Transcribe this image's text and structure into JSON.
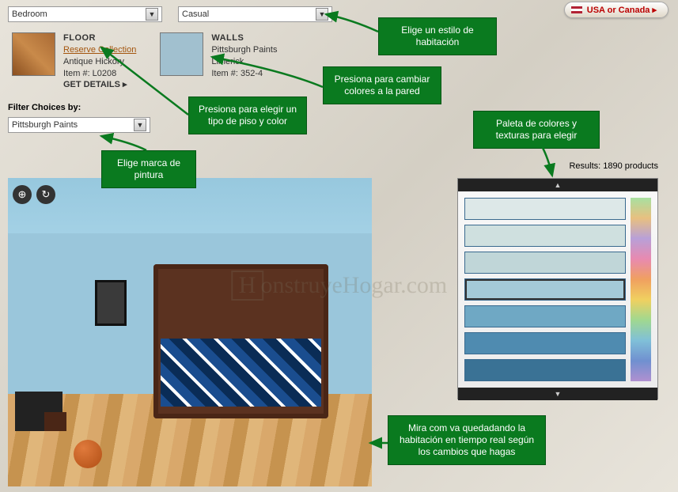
{
  "header": {
    "room_select": "Bedroom",
    "style_select": "Casual",
    "region_button": "USA or Canada ▸"
  },
  "floor_card": {
    "title": "FLOOR",
    "link": "Reserve Collection",
    "product": "Antique Hickory",
    "item": "Item #: L0208",
    "details": "GET DETAILS  ▸",
    "swatch_color": "#a96a34"
  },
  "walls_card": {
    "title": "WALLS",
    "brand": "Pittsburgh Paints",
    "product": "Limerick",
    "item": "Item #: 352-4",
    "swatch_color": "#a1c0cf"
  },
  "filter": {
    "label": "Filter Choices by:",
    "value": "Pittsburgh Paints"
  },
  "results": {
    "text": "Results: 1890 products"
  },
  "palette": {
    "swatches": [
      "#dde8e8",
      "#cfe0df",
      "#c0d6d8",
      "#a4cad8",
      "#6fa8c4",
      "#4f8bb0",
      "#3a7295"
    ],
    "selected_index": 3
  },
  "callouts": {
    "c1": "Elige un estilo de habitación",
    "c2": "Presiona para cambiar colores a la pared",
    "c3": "Presiona para elegir un tipo de piso y color",
    "c4": "Elige marca de pintura",
    "c5": "Paleta de colores y texturas para elegir",
    "c6": "Mira com va quedadando la habitación en tiempo real según  los cambios que hagas"
  },
  "watermark": "onstruyeHogar.com"
}
